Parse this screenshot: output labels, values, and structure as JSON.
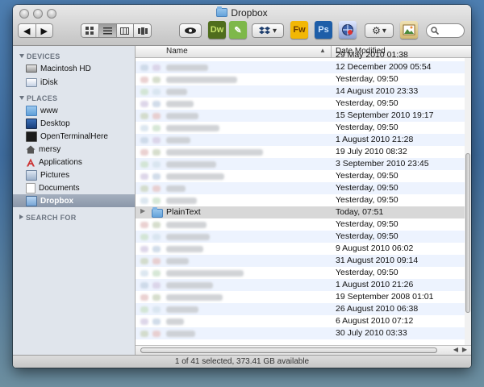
{
  "window": {
    "title": "Dropbox"
  },
  "toolbar": {
    "view_modes": [
      "icon-view",
      "list-view",
      "column-view",
      "cover-flow-view"
    ],
    "apps": [
      {
        "name": "dreamweaver",
        "label": "Dw",
        "color": "#4f6d1d",
        "text": "#c7e36b"
      },
      {
        "name": "textmate",
        "label": "✎",
        "color": "#7eb84a",
        "text": "#fff"
      },
      {
        "name": "fireworks",
        "label": "Fw",
        "color": "#f2b705",
        "text": "#6a3b00"
      },
      {
        "name": "photoshop",
        "label": "Ps",
        "color": "#1e5ea8",
        "text": "#cfe6ff"
      }
    ]
  },
  "sidebar": {
    "devices_header": "DEVICES",
    "devices": [
      {
        "label": "Macintosh HD",
        "icon": "hard-drive-icon"
      },
      {
        "label": "iDisk",
        "icon": "idisk-icon"
      }
    ],
    "places_header": "PLACES",
    "places": [
      {
        "label": "www",
        "icon": "folder-icon"
      },
      {
        "label": "Desktop",
        "icon": "desktop-icon"
      },
      {
        "label": "OpenTerminalHere",
        "icon": "terminal-icon"
      },
      {
        "label": "mersy",
        "icon": "home-icon"
      },
      {
        "label": "Applications",
        "icon": "applications-icon"
      },
      {
        "label": "Pictures",
        "icon": "pictures-icon"
      },
      {
        "label": "Documents",
        "icon": "documents-icon"
      },
      {
        "label": "Dropbox",
        "icon": "dropbox-folder-icon",
        "selected": true
      }
    ],
    "search_header": "SEARCH FOR"
  },
  "columns": {
    "name": "Name",
    "date": "Date Modified"
  },
  "rows": [
    {
      "date": "12 December 2009 05:54"
    },
    {
      "date": "Yesterday, 09:50"
    },
    {
      "date": "14 August 2010 23:33"
    },
    {
      "date": "Yesterday, 09:50"
    },
    {
      "date": "15 September 2010 19:17"
    },
    {
      "date": "Yesterday, 09:50"
    },
    {
      "date": "1 August 2010 21:28"
    },
    {
      "date": "19 July 2010 08:32"
    },
    {
      "date": "3 September 2010 23:45"
    },
    {
      "date": "Yesterday, 09:50"
    },
    {
      "date": "Yesterday, 09:50"
    },
    {
      "date": "Yesterday, 09:50"
    },
    {
      "date": "Today, 07:51",
      "name": "PlainText",
      "selected": true
    },
    {
      "date": "Yesterday, 09:50"
    },
    {
      "date": "Yesterday, 09:50"
    },
    {
      "date": "9 August 2010 06:02"
    },
    {
      "date": "31 August 2010 09:14"
    },
    {
      "date": "Yesterday, 09:50"
    },
    {
      "date": "1 August 2010 21:26"
    },
    {
      "date": "19 September 2008 01:01"
    },
    {
      "date": "26 August 2010 06:38"
    },
    {
      "date": "6 August 2010 07:12"
    },
    {
      "date": "30 July 2010 03:33"
    }
  ],
  "partial_top_date": "29 May 2010 01:38",
  "status": "1 of 41 selected, 373.41 GB available"
}
